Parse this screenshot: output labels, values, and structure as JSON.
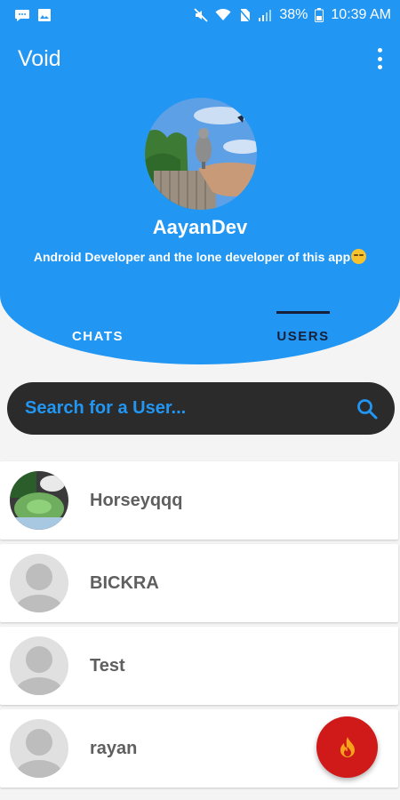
{
  "status_bar": {
    "left_icons": [
      "chat-bubble-icon",
      "image-icon"
    ],
    "right_icons": [
      "mute-icon",
      "wifi-icon",
      "no-sim-icon",
      "signal-icon"
    ],
    "battery": "38%",
    "time": "10:39 AM"
  },
  "app": {
    "title": "Void",
    "menu_icon": "more-vert-icon"
  },
  "profile": {
    "name": "AayanDev",
    "bio": "Android Developer and the lone developer of this app",
    "bio_emoji": "sly-face-emoji"
  },
  "tabs": [
    {
      "label": "CHATS",
      "selected": false
    },
    {
      "label": "USERS",
      "selected": true
    }
  ],
  "search": {
    "placeholder": "Search for a User...",
    "value": ""
  },
  "users": [
    {
      "name": "Horseyqqq",
      "avatar": "photo"
    },
    {
      "name": "BICKRA",
      "avatar": "default"
    },
    {
      "name": "Test",
      "avatar": "default"
    },
    {
      "name": "rayan",
      "avatar": "default"
    }
  ],
  "fab": {
    "icon": "fire-icon"
  },
  "colors": {
    "primary": "#2196f3",
    "tab_selected": "#17203a",
    "search_bg": "#2b2b2b",
    "fab": "#d01a1a"
  }
}
